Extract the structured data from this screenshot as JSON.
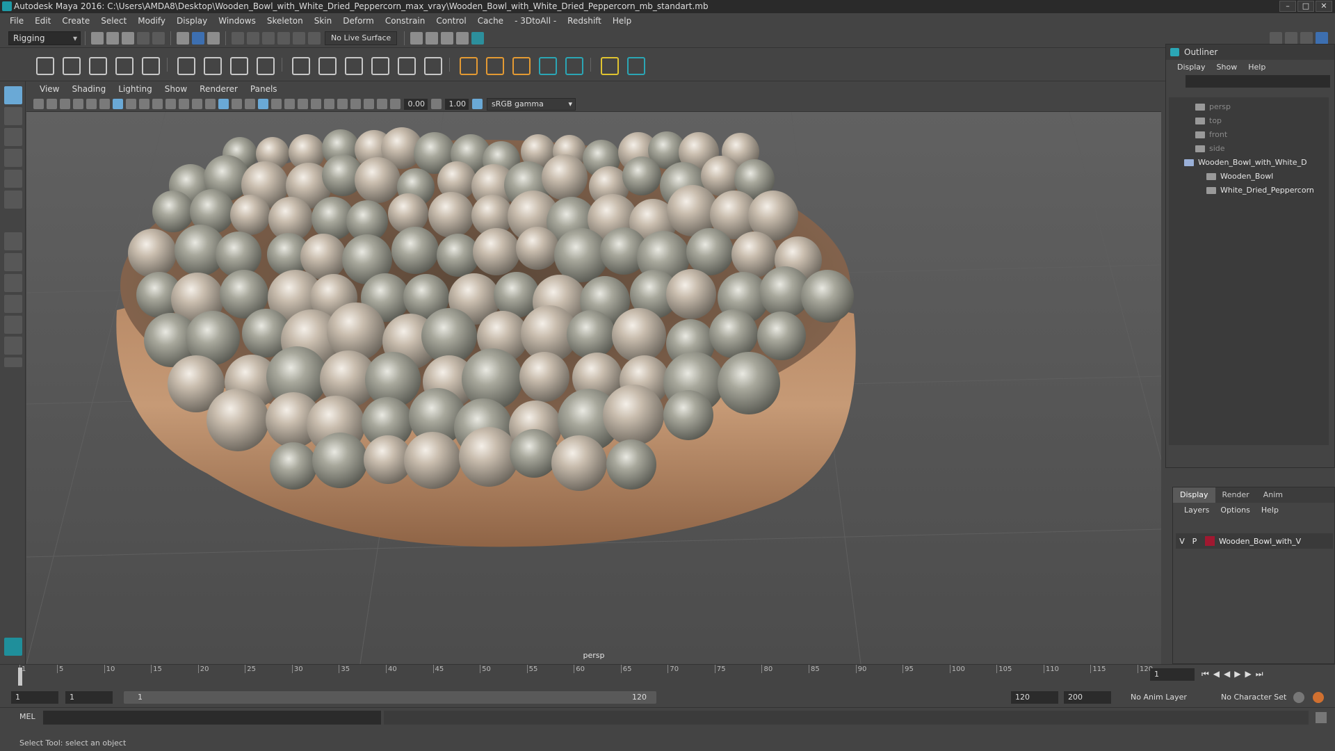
{
  "title": "Autodesk Maya 2016: C:\\Users\\AMDA8\\Desktop\\Wooden_Bowl_with_White_Dried_Peppercorn_max_vray\\Wooden_Bowl_with_White_Dried_Peppercorn_mb_standart.mb",
  "menu": [
    "File",
    "Edit",
    "Create",
    "Select",
    "Modify",
    "Display",
    "Windows",
    "Skeleton",
    "Skin",
    "Deform",
    "Constrain",
    "Control",
    "Cache",
    "- 3DtoAll -",
    "Redshift",
    "Help"
  ],
  "menuset": "Rigging",
  "live_surface": "No Live Surface",
  "viewport": {
    "menu": [
      "View",
      "Shading",
      "Lighting",
      "Show",
      "Renderer",
      "Panels"
    ],
    "exposure": "0.00",
    "gamma": "1.00",
    "color_space": "sRGB gamma",
    "camera": "persp"
  },
  "outliner": {
    "title": "Outliner",
    "menu": [
      "Display",
      "Show",
      "Help"
    ],
    "items": [
      {
        "label": "persp",
        "kind": "camera"
      },
      {
        "label": "top",
        "kind": "camera"
      },
      {
        "label": "front",
        "kind": "camera"
      },
      {
        "label": "side",
        "kind": "camera"
      },
      {
        "label": "Wooden_Bowl_with_White_D",
        "kind": "group"
      },
      {
        "label": "Wooden_Bowl",
        "kind": "mesh"
      },
      {
        "label": "White_Dried_Peppercorn",
        "kind": "mesh"
      }
    ]
  },
  "layers": {
    "tabs": [
      "Display",
      "Render",
      "Anim"
    ],
    "menu": [
      "Layers",
      "Options",
      "Help"
    ],
    "row": {
      "v": "V",
      "p": "P",
      "name": "Wooden_Bowl_with_V",
      "color": "#a01830"
    }
  },
  "timeline": {
    "ticks": [
      "1",
      "5",
      "10",
      "15",
      "20",
      "25",
      "30",
      "35",
      "40",
      "45",
      "50",
      "55",
      "60",
      "65",
      "70",
      "75",
      "80",
      "85",
      "90",
      "95",
      "100",
      "105",
      "110",
      "115",
      "120"
    ],
    "current_frame": "1"
  },
  "range": {
    "start": "1",
    "inner_start": "1",
    "slider_start": "1",
    "slider_end": "120",
    "end": "120",
    "outer_end": "200",
    "anim_layer": "No Anim Layer",
    "char_set": "No Character Set"
  },
  "mel_label": "MEL",
  "help_text": "Select Tool: select an object"
}
